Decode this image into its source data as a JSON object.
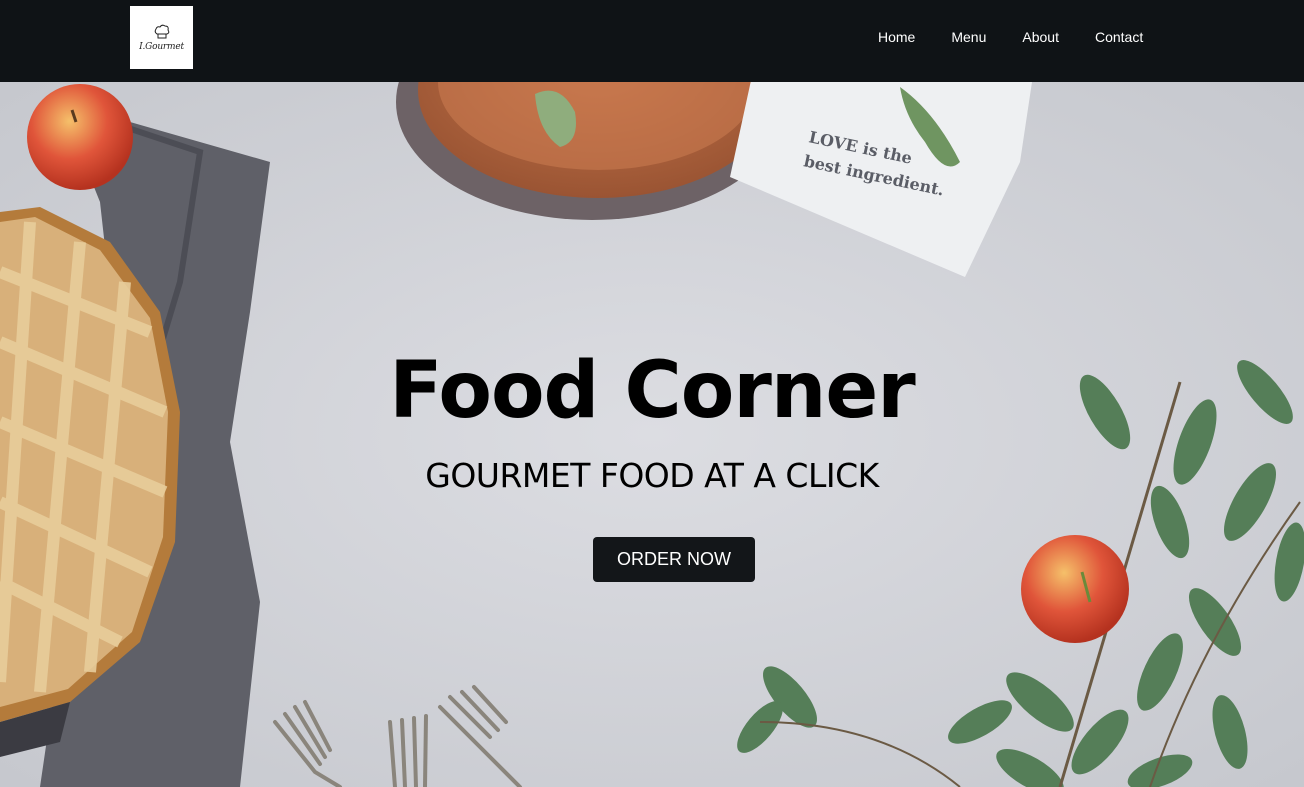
{
  "brand": {
    "logo_text": "I.Gourmet"
  },
  "nav": {
    "items": [
      {
        "label": "Home"
      },
      {
        "label": "Menu"
      },
      {
        "label": "About"
      },
      {
        "label": "Contact"
      }
    ]
  },
  "hero": {
    "title": "Food Corner",
    "subtitle": "GOURMET FOOD AT A CLICK",
    "cta_label": "ORDER NOW",
    "napkin_text_line1": "LOVE is the",
    "napkin_text_line2": "best ingredient."
  },
  "colors": {
    "navbar_bg": "#0f1316",
    "button_bg": "#131619",
    "hero_bg": "#d3d4d9"
  }
}
